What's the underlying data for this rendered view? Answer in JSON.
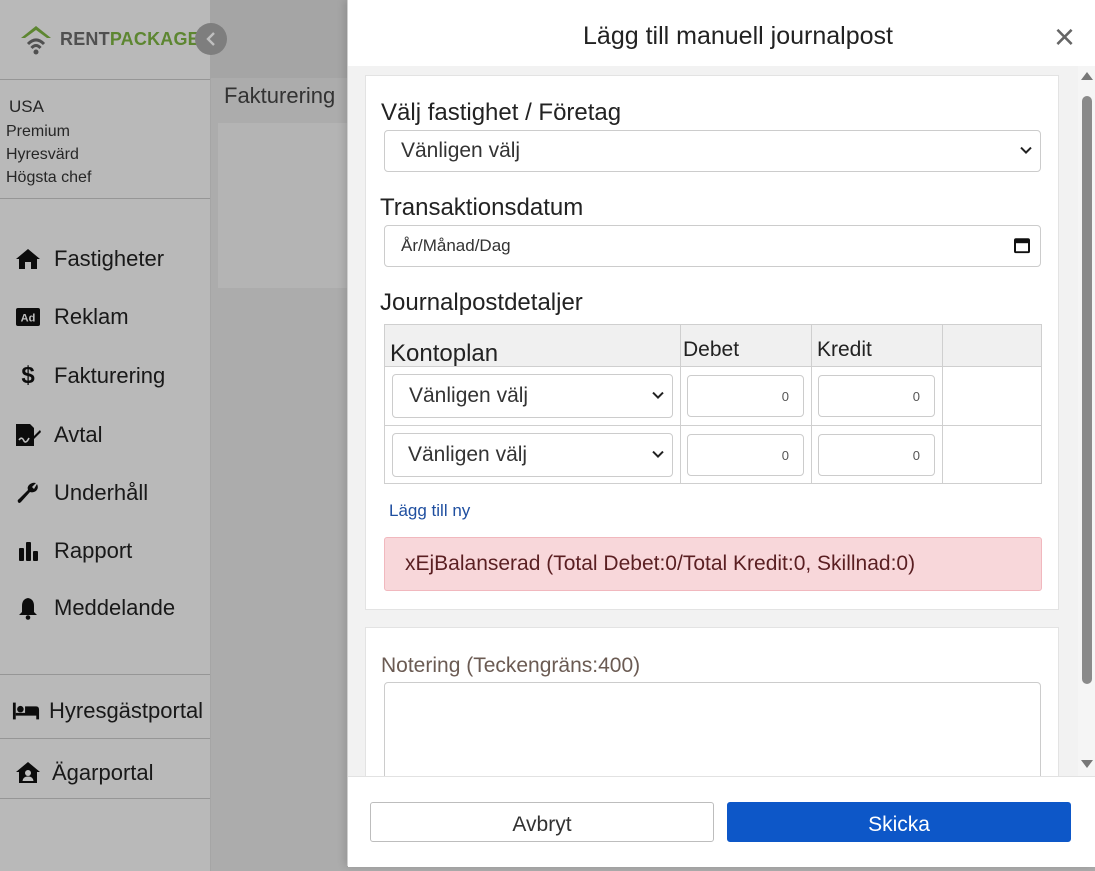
{
  "brand": {
    "rent": "RENT",
    "package": "PACKAGE",
    "green": "#7cb342"
  },
  "user": {
    "country": "USA",
    "plan": "Premium",
    "role": "Hyresvärd",
    "title": "Högsta chef"
  },
  "nav": [
    {
      "label": "Fastigheter",
      "icon": "home-icon"
    },
    {
      "label": "Reklam",
      "icon": "ad-icon"
    },
    {
      "label": "Fakturering",
      "icon": "dollar-icon"
    },
    {
      "label": "Avtal",
      "icon": "contract-icon"
    },
    {
      "label": "Underhåll",
      "icon": "wrench-icon"
    },
    {
      "label": "Rapport",
      "icon": "bar-chart-icon"
    },
    {
      "label": "Meddelande",
      "icon": "bell-icon"
    }
  ],
  "portals": [
    {
      "label": "Hyresgästportal",
      "icon": "bed-icon"
    },
    {
      "label": "Ägarportal",
      "icon": "house-user-icon"
    }
  ],
  "main": {
    "title": "Fakturering"
  },
  "modal": {
    "title": "Lägg till manuell journalpost",
    "property_label": "Välj fastighet / Företag",
    "property_value": "Vänligen välj",
    "date_label": "Transaktionsdatum",
    "date_placeholder": "År/Månad/Dag",
    "details_label": "Journalpostdetaljer",
    "columns": [
      "Kontoplan",
      "Debet",
      "Kredit",
      ""
    ],
    "rows": [
      {
        "account": "Vänligen välj",
        "debit": "0",
        "credit": "0"
      },
      {
        "account": "Vänligen välj",
        "debit": "0",
        "credit": "0"
      }
    ],
    "add_new": "Lägg till ny",
    "alert": "xEjBalanserad (Total Debet:0/Total Kredit:0, Skillnad:0)",
    "notes_label": "Notering (Teckengräns:400)",
    "cancel": "Avbryt",
    "submit": "Skicka",
    "submit_color": "#0d57c8"
  }
}
